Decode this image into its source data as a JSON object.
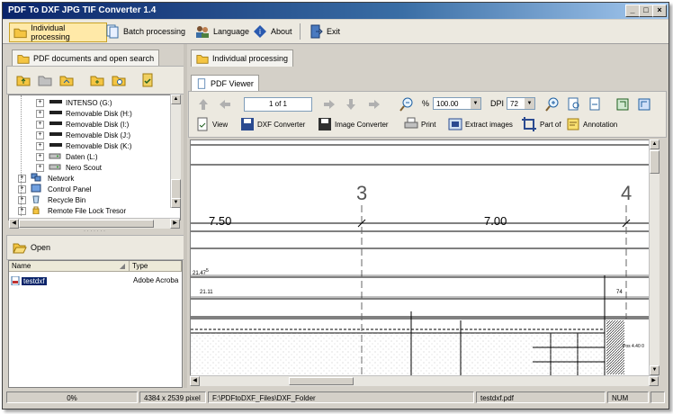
{
  "window": {
    "title": "PDF To DXF JPG TIF Converter 1.4",
    "controls": [
      "_",
      "□",
      "×"
    ]
  },
  "toolbar": {
    "individual": "Individual processing",
    "batch": "Batch processing",
    "language": "Language",
    "about": "About",
    "exit": "Exit"
  },
  "left": {
    "tab": "PDF documents and open search",
    "tree": [
      {
        "label": "INTENSO (G:)",
        "level": 2
      },
      {
        "label": "Removable Disk (H:)",
        "level": 2
      },
      {
        "label": "Removable Disk (I:)",
        "level": 2
      },
      {
        "label": "Removable Disk (J:)",
        "level": 2
      },
      {
        "label": "Removable Disk (K:)",
        "level": 2
      },
      {
        "label": "Daten (L:)",
        "level": 2
      },
      {
        "label": "Nero Scout",
        "level": 2
      },
      {
        "label": "Network",
        "level": 1
      },
      {
        "label": "Control Panel",
        "level": 1
      },
      {
        "label": "Recycle Bin",
        "level": 1
      },
      {
        "label": "Remote File Lock Tresor",
        "level": 1
      }
    ],
    "open": "Open",
    "columns": {
      "name": "Name",
      "type": "Type"
    },
    "file": {
      "name": "testdxf",
      "type": "Adobe Acroba"
    }
  },
  "right": {
    "tab": "Individual processing",
    "subtab": "PDF Viewer",
    "page": "1 of 1",
    "zoom_symbol": "%",
    "zoom": "100.00",
    "dpi_label": "DPI",
    "dpi": "72",
    "actions": {
      "view": "View",
      "dxf": "DXF Converter",
      "image": "Image Converter",
      "print": "Print",
      "extract": "Extract images",
      "partof": "Part of",
      "annotation": "Annotation"
    }
  },
  "drawing": {
    "col3": "3",
    "col4": "4",
    "dim1": "7.50",
    "dim2": "7.00",
    "l1": "21.47",
    "l1sup": "5",
    "l2": "21.11",
    "d74": "74",
    "pos": "Pos 4.40 0"
  },
  "status": {
    "progress": "0%",
    "size": "4384 x 2539 pixel",
    "path": "F:\\PDFtoDXF_Files\\DXF_Folder",
    "file": "testdxf.pdf",
    "mode": "NUM"
  }
}
